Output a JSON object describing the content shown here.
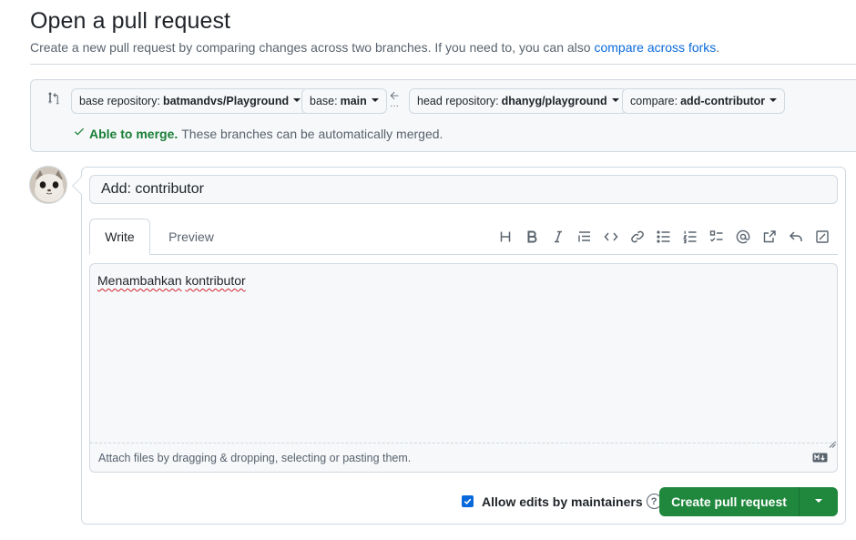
{
  "page": {
    "title": "Open a pull request",
    "subtitle_prefix": "Create a new pull request by comparing changes across two branches. If you need to, you can also",
    "subtitle_link": "compare across forks",
    "subtitle_suffix": "."
  },
  "compare": {
    "base_repo_label": "base repository:",
    "base_repo_value": "batmandvs/Playground",
    "base_label": "base:",
    "base_value": "main",
    "head_repo_label": "head repository:",
    "head_repo_value": "dhanyg/playground",
    "compare_label": "compare:",
    "compare_value": "add-contributor",
    "merge_ok": "Able to merge.",
    "merge_text": "These branches can be automatically merged."
  },
  "form": {
    "title_value": "Add: contributor",
    "tabs": [
      "Write",
      "Preview"
    ],
    "toolbar_icons": [
      "heading-icon",
      "bold-icon",
      "italic-icon",
      "quote-icon",
      "code-icon",
      "link-icon",
      "unordered-list-icon",
      "ordered-list-icon",
      "task-list-icon",
      "mention-icon",
      "cross-reference-icon",
      "reply-icon",
      "fullscreen-icon"
    ],
    "body_word1": "Menambahkan",
    "body_word2": "kontributor",
    "attach_text": "Attach files by dragging & dropping, selecting or pasting them."
  },
  "footer": {
    "allow_edits_label": "Allow edits by maintainers",
    "allow_edits_checked": true,
    "create_button": "Create pull request"
  },
  "colors": {
    "accent": "#0969da",
    "success": "#1a7f37",
    "button_green": "#1f883d"
  }
}
